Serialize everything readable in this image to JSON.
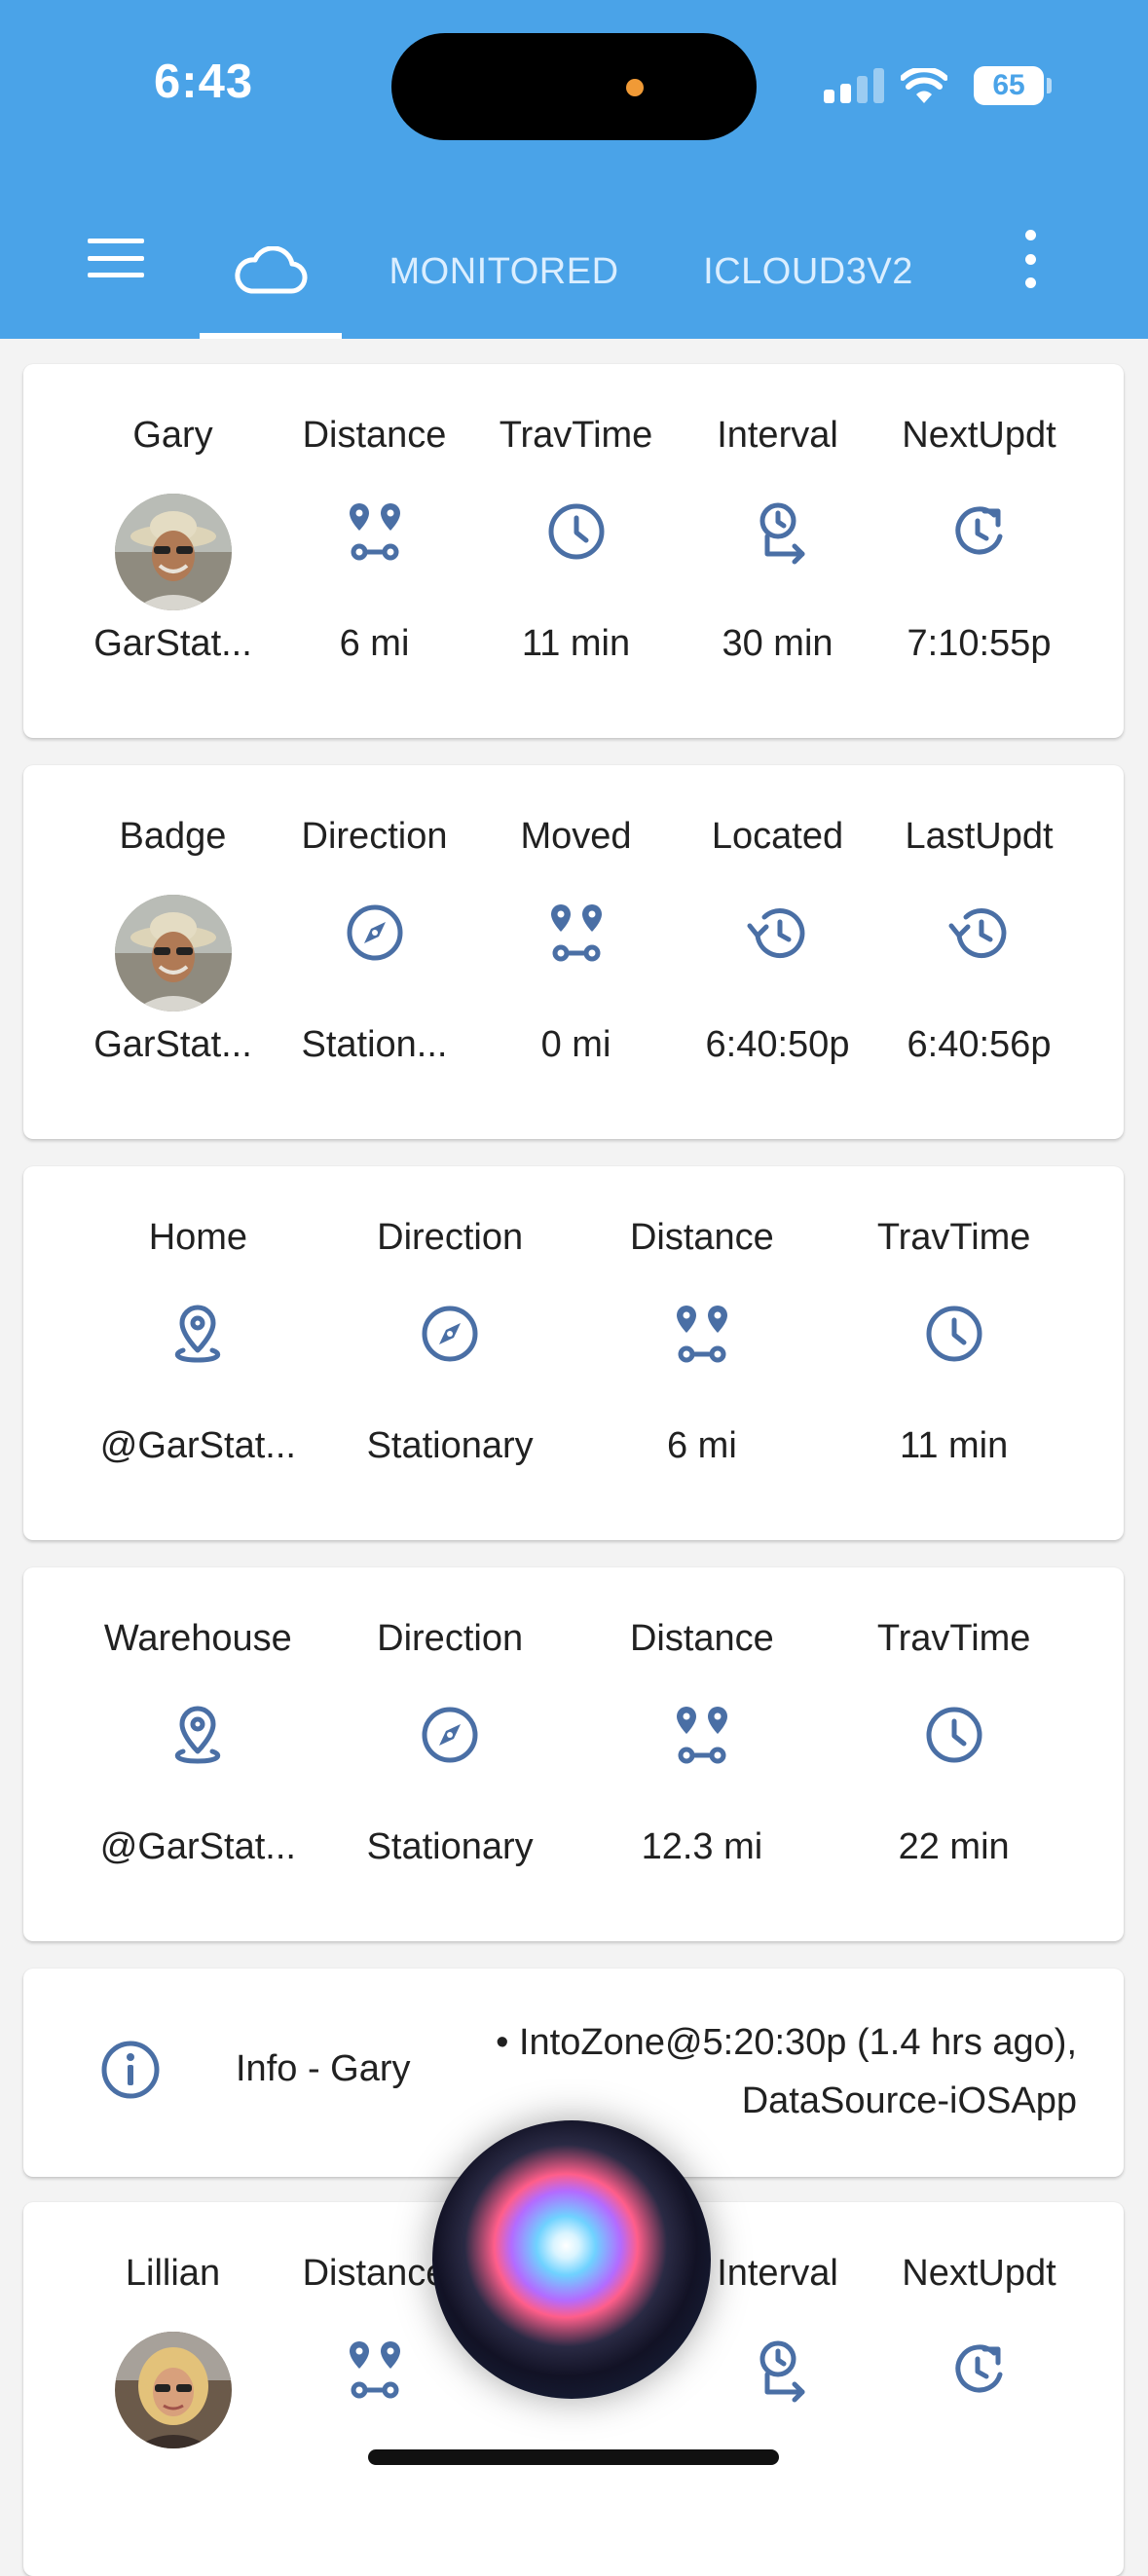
{
  "status_bar": {
    "time": "6:43",
    "battery": "65"
  },
  "tabs": {
    "monitored": "MONITORED",
    "icloud": "ICLOUD3V2"
  },
  "cards": [
    {
      "type": "grid",
      "cells": [
        {
          "header": "Gary",
          "icon": "avatar-gary",
          "value": "GarStat..."
        },
        {
          "header": "Distance",
          "icon": "route-icon",
          "value": "6 mi"
        },
        {
          "header": "TravTime",
          "icon": "clock-icon",
          "value": "11 min"
        },
        {
          "header": "Interval",
          "icon": "timer-interval-icon",
          "value": "30 min"
        },
        {
          "header": "NextUpdt",
          "icon": "clock-refresh-icon",
          "value": "7:10:55p"
        }
      ]
    },
    {
      "type": "grid",
      "cells": [
        {
          "header": "Badge",
          "icon": "avatar-gary",
          "value": "GarStat..."
        },
        {
          "header": "Direction",
          "icon": "compass-icon",
          "value": "Station..."
        },
        {
          "header": "Moved",
          "icon": "route-icon",
          "value": "0 mi"
        },
        {
          "header": "Located",
          "icon": "history-icon",
          "value": "6:40:50p"
        },
        {
          "header": "LastUpdt",
          "icon": "history-icon",
          "value": "6:40:56p"
        }
      ]
    },
    {
      "type": "grid",
      "cells": [
        {
          "header": "Home",
          "icon": "map-marker-icon",
          "value": "@GarStat..."
        },
        {
          "header": "Direction",
          "icon": "compass-icon",
          "value": "Stationary"
        },
        {
          "header": "Distance",
          "icon": "route-icon",
          "value": "6 mi"
        },
        {
          "header": "TravTime",
          "icon": "clock-icon",
          "value": "11 min"
        }
      ]
    },
    {
      "type": "grid",
      "cells": [
        {
          "header": "Warehouse",
          "icon": "map-marker-icon",
          "value": "@GarStat..."
        },
        {
          "header": "Direction",
          "icon": "compass-icon",
          "value": "Stationary"
        },
        {
          "header": "Distance",
          "icon": "route-icon",
          "value": "12.3 mi"
        },
        {
          "header": "TravTime",
          "icon": "clock-icon",
          "value": "22 min"
        }
      ]
    },
    {
      "type": "info",
      "label": "Info - Gary",
      "text": "• IntoZone@5:20:30p (1.4 hrs ago), DataSource-iOSApp"
    },
    {
      "type": "grid",
      "cells": [
        {
          "header": "Lillian",
          "icon": "avatar-lillian",
          "value": ""
        },
        {
          "header": "Distance",
          "icon": "route-icon",
          "value": ""
        },
        {
          "header": "",
          "icon": "clock-icon",
          "value": ""
        },
        {
          "header": "Interval",
          "icon": "timer-interval-icon",
          "value": ""
        },
        {
          "header": "NextUpdt",
          "icon": "clock-refresh-icon",
          "value": ""
        }
      ]
    }
  ],
  "colors": {
    "app_bar": "#4aa3e8",
    "icon": "#4a6fa5",
    "card": "#ffffff",
    "background": "#f3f3f3"
  }
}
